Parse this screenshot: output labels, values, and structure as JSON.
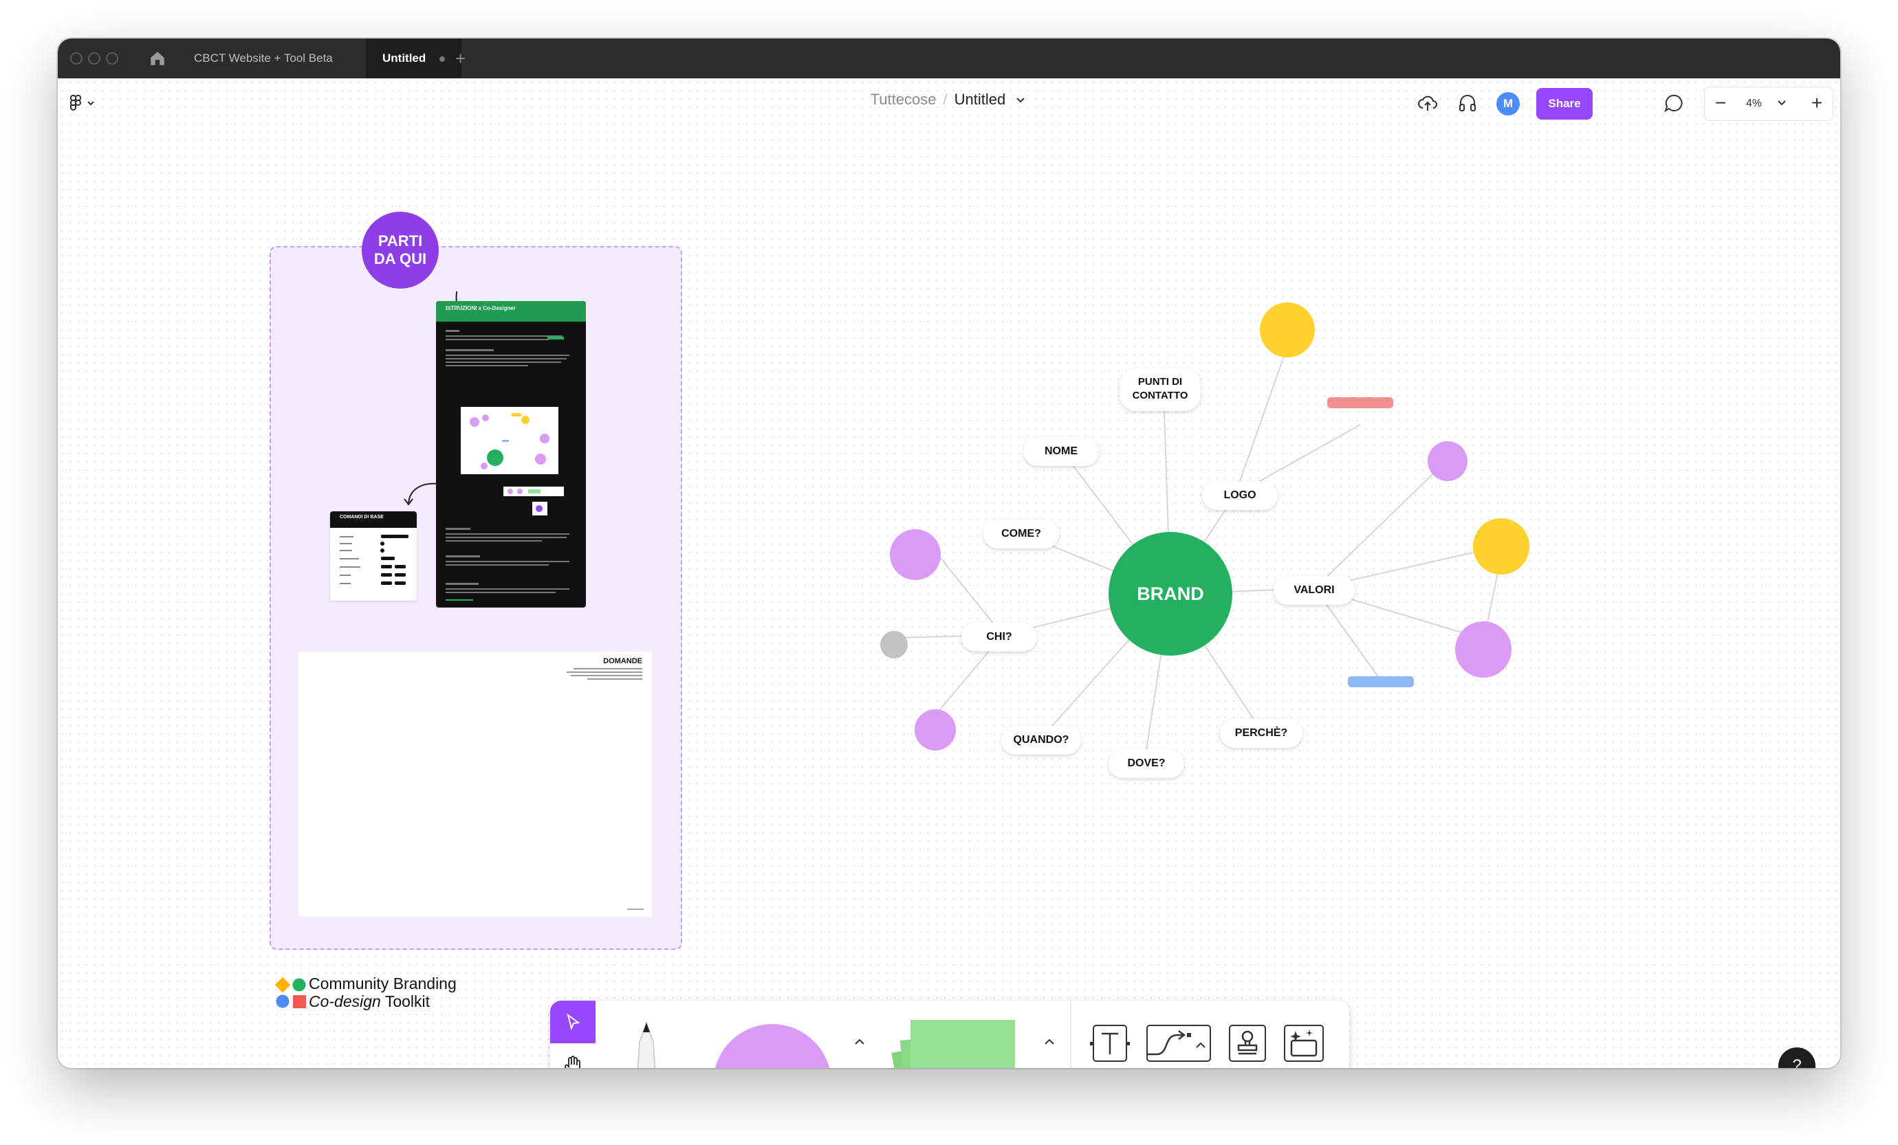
{
  "titlebar": {
    "tabs": [
      {
        "label": "CBCT Website + Tool Beta"
      },
      {
        "label": "Untitled"
      }
    ],
    "new_tab": "+"
  },
  "header": {
    "team": "Tuttecose",
    "separator": "/",
    "file": "Untitled",
    "avatar": "M",
    "share_label": "Share",
    "zoom": "4%",
    "zoom_minus": "−",
    "zoom_plus": "+"
  },
  "section": {
    "start_label_1": "PARTI",
    "start_label_2": "DA QUI",
    "instructions_title": "ISTRUZIONI x Co-Designer",
    "commands_title": "COMANDI DI BASE",
    "questions_title": "DOMANDE"
  },
  "logo": {
    "line1": "Community Branding",
    "line2_italic": "Co-design",
    "line2_rest": " Toolkit"
  },
  "mindmap": {
    "center": "BRAND",
    "nodes": {
      "punti_line1": "PUNTI DI",
      "punti_line2": "CONTATTO",
      "nome": "NOME",
      "logo": "LOGO",
      "come": "COME?",
      "valori": "VALORI",
      "chi": "CHI?",
      "quando": "QUANDO?",
      "dove": "DOVE?",
      "perche": "PERCHÈ?"
    }
  },
  "help": "?",
  "colors": {
    "accent_purple": "#9747ff",
    "brand_green": "#22b15e",
    "yellow": "#ffd12e",
    "lavender": "#d99bf5",
    "red_bar": "#f58f8f",
    "blue_bar": "#8fb8f5",
    "sticky_green": "#96e294"
  }
}
